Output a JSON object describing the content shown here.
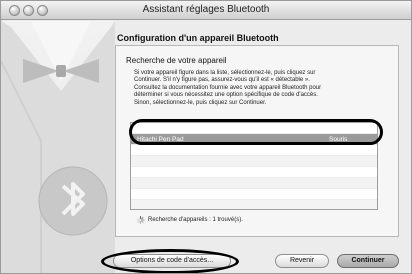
{
  "window": {
    "title": "Assistant réglages Bluetooth"
  },
  "page": {
    "heading": "Configuration d'un appareil Bluetooth",
    "subheading": "Recherche de votre appareil",
    "description_lines": [
      "Si votre appareil figure dans la liste, sélectionnez-le, puis cliquez sur",
      "Continuer. S'il n'y figure pas, assurez-vous qu'il est « détectable ».",
      "Consultez la documentation fournie avec votre appareil Bluetooth pour",
      "déterminer si vous nécessitez une option spécifique de code d'accès.",
      "Sinon, sélectionnez-le, puis cliquez sur Continuer."
    ]
  },
  "device_list": {
    "items": [
      {
        "name": "Hitachi Pen Pad",
        "type": "Souris",
        "selected": true
      }
    ]
  },
  "status": {
    "text": "Recherche d'appareils : 1 trouvé(s)."
  },
  "buttons": {
    "options": "Options de code d'accès...",
    "back": "Revenir",
    "continue": "Continuer"
  },
  "icons": {
    "window_controls": [
      "close-icon",
      "minimize-icon",
      "zoom-icon"
    ],
    "background_art": "bluetooth-tuxedo-icon",
    "spinner": "progress-spinner-icon"
  },
  "colors": {
    "window_bg": "#ececec",
    "selection": "#9a9a9a",
    "annotation": "#000000"
  }
}
